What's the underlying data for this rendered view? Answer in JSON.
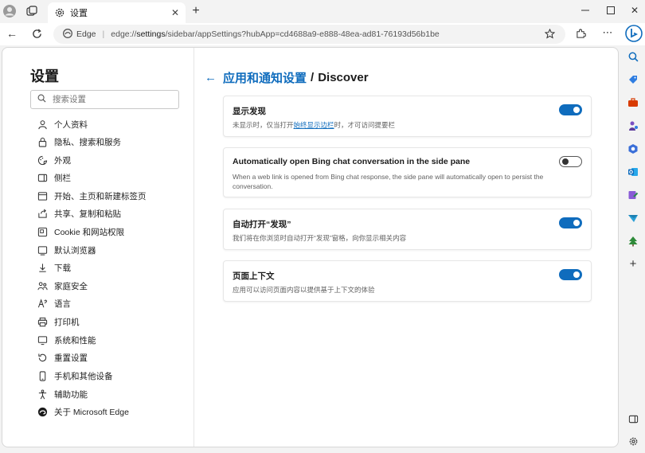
{
  "browser": {
    "tab_title": "设置",
    "address_label": "Edge",
    "url_prefix": "edge://",
    "url_host": "settings",
    "url_path": "/sidebar/appSettings?hubApp=cd4688a9-e888-48ea-ad81-76193d56b1be"
  },
  "nav": {
    "title": "设置",
    "search_placeholder": "搜索设置",
    "items": [
      {
        "label": "个人资料",
        "icon": "profile-icon"
      },
      {
        "label": "隐私、搜索和服务",
        "icon": "lock-icon"
      },
      {
        "label": "外观",
        "icon": "appearance-icon"
      },
      {
        "label": "侧栏",
        "icon": "sidebar-icon"
      },
      {
        "label": "开始、主页和新建标签页",
        "icon": "home-icon"
      },
      {
        "label": "共享、复制和粘贴",
        "icon": "share-icon"
      },
      {
        "label": "Cookie 和网站权限",
        "icon": "cookie-icon"
      },
      {
        "label": "默认浏览器",
        "icon": "browser-icon"
      },
      {
        "label": "下载",
        "icon": "download-icon"
      },
      {
        "label": "家庭安全",
        "icon": "family-icon"
      },
      {
        "label": "语言",
        "icon": "language-icon"
      },
      {
        "label": "打印机",
        "icon": "printer-icon"
      },
      {
        "label": "系统和性能",
        "icon": "system-icon"
      },
      {
        "label": "重置设置",
        "icon": "reset-icon"
      },
      {
        "label": "手机和其他设备",
        "icon": "phone-icon"
      },
      {
        "label": "辅助功能",
        "icon": "accessibility-icon"
      },
      {
        "label": "关于 Microsoft Edge",
        "icon": "edge-icon"
      }
    ]
  },
  "main": {
    "breadcrumb_parent": "应用和通知设置",
    "breadcrumb_sep": "/",
    "breadcrumb_current": "Discover",
    "cards": [
      {
        "title": "显示发现",
        "desc_before": "未显示时，仅当打开",
        "desc_link": "始终显示边栏",
        "desc_after": "时，才可访问提要栏",
        "toggle": "on"
      },
      {
        "title": "Automatically open Bing chat conversation in the side pane",
        "desc": "When a web link is opened from Bing chat response, the side pane will automatically open to persist the conversation.",
        "toggle": "off"
      },
      {
        "title": "自动打开“发现”",
        "desc": "我们将在你浏览时自动打开“发现”窗格，向你显示相关内容",
        "toggle": "on"
      },
      {
        "title": "页面上下文",
        "desc": "应用可以访问页面内容以提供基于上下文的体验",
        "toggle": "on"
      }
    ]
  },
  "colors": {
    "accent": "#0f6cbd"
  }
}
